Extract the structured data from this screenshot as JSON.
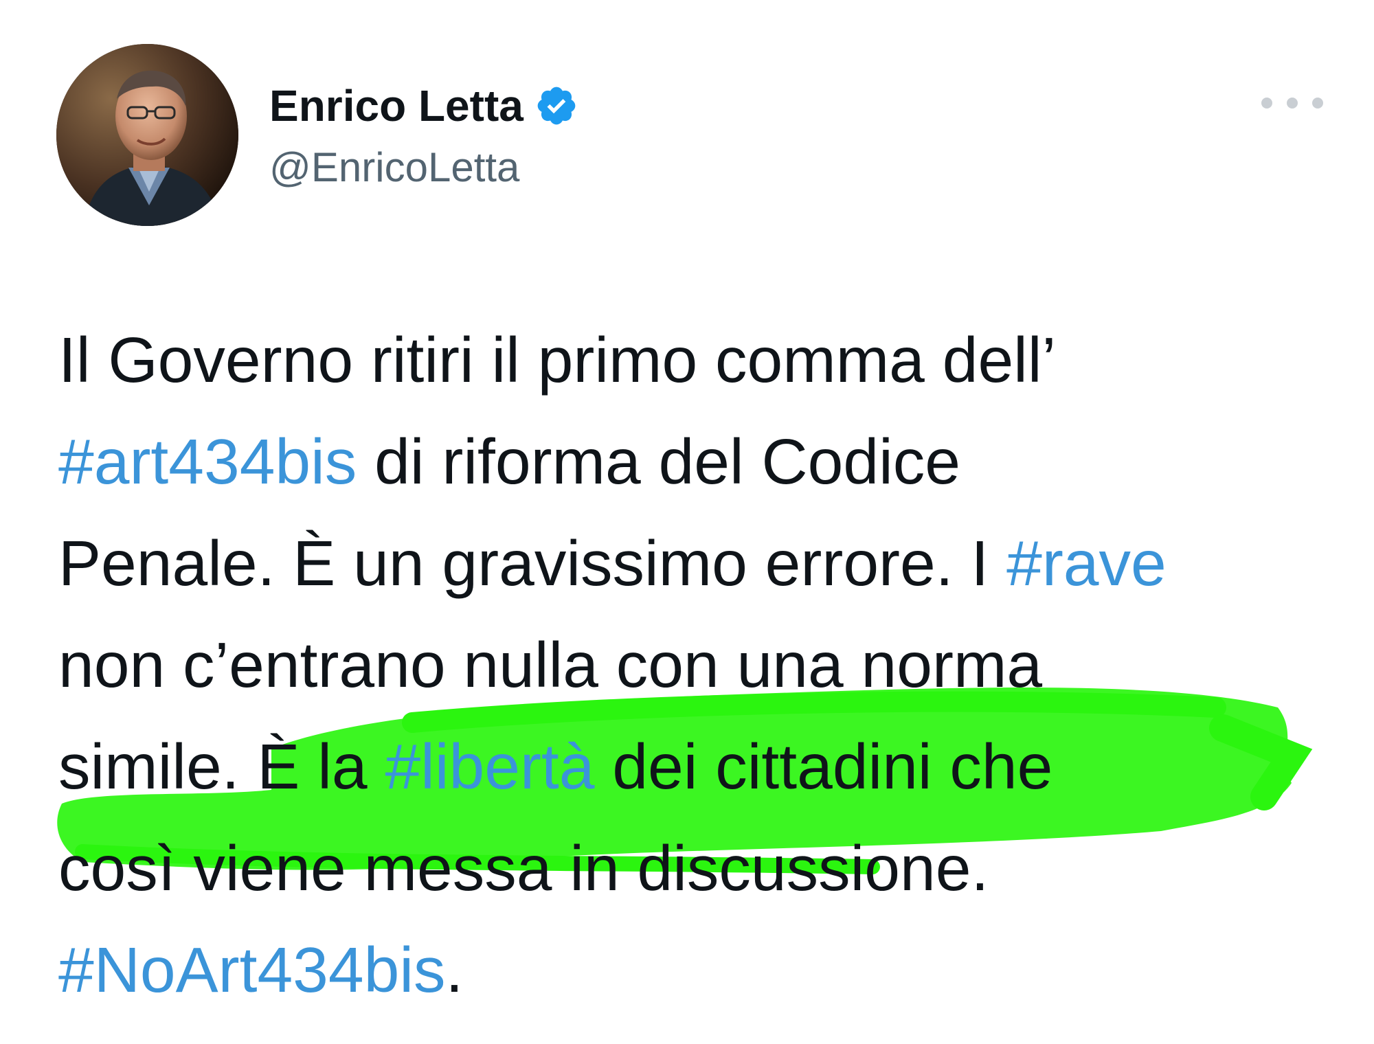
{
  "author": {
    "display_name": "Enrico Letta",
    "handle": "@EnricoLetta",
    "verified": true,
    "avatar_icon": "profile-photo"
  },
  "menu": {
    "more_icon": "ellipsis-icon"
  },
  "tweet": {
    "lines": [
      [
        {
          "text": "Il Governo ritiri il primo comma dell’",
          "hashtag": false
        }
      ],
      [
        {
          "text": "#art434bis",
          "hashtag": true
        },
        {
          "text": " di riforma del Codice",
          "hashtag": false
        }
      ],
      [
        {
          "text": "Penale. È un gravissimo errore. I ",
          "hashtag": false
        },
        {
          "text": "#rave",
          "hashtag": true
        }
      ],
      [
        {
          "text": "non c’entrano nulla con una norma",
          "hashtag": false
        }
      ],
      [
        {
          "text": "simile. È la ",
          "hashtag": false
        },
        {
          "text": "#libertà",
          "hashtag": true
        },
        {
          "text": " dei cittadini che",
          "hashtag": false
        }
      ],
      [
        {
          "text": "così viene messa in discussione.",
          "hashtag": false
        }
      ],
      [
        {
          "text": "#NoArt434bis",
          "hashtag": true
        },
        {
          "text": ".",
          "hashtag": false
        }
      ]
    ]
  },
  "colors": {
    "text": "#0f1419",
    "handle": "#536471",
    "hashtag": "#3b94d9",
    "verified_badge": "#1d9bf0",
    "highlighter": "#2bf50f",
    "more_dots": "#c9ced3"
  }
}
